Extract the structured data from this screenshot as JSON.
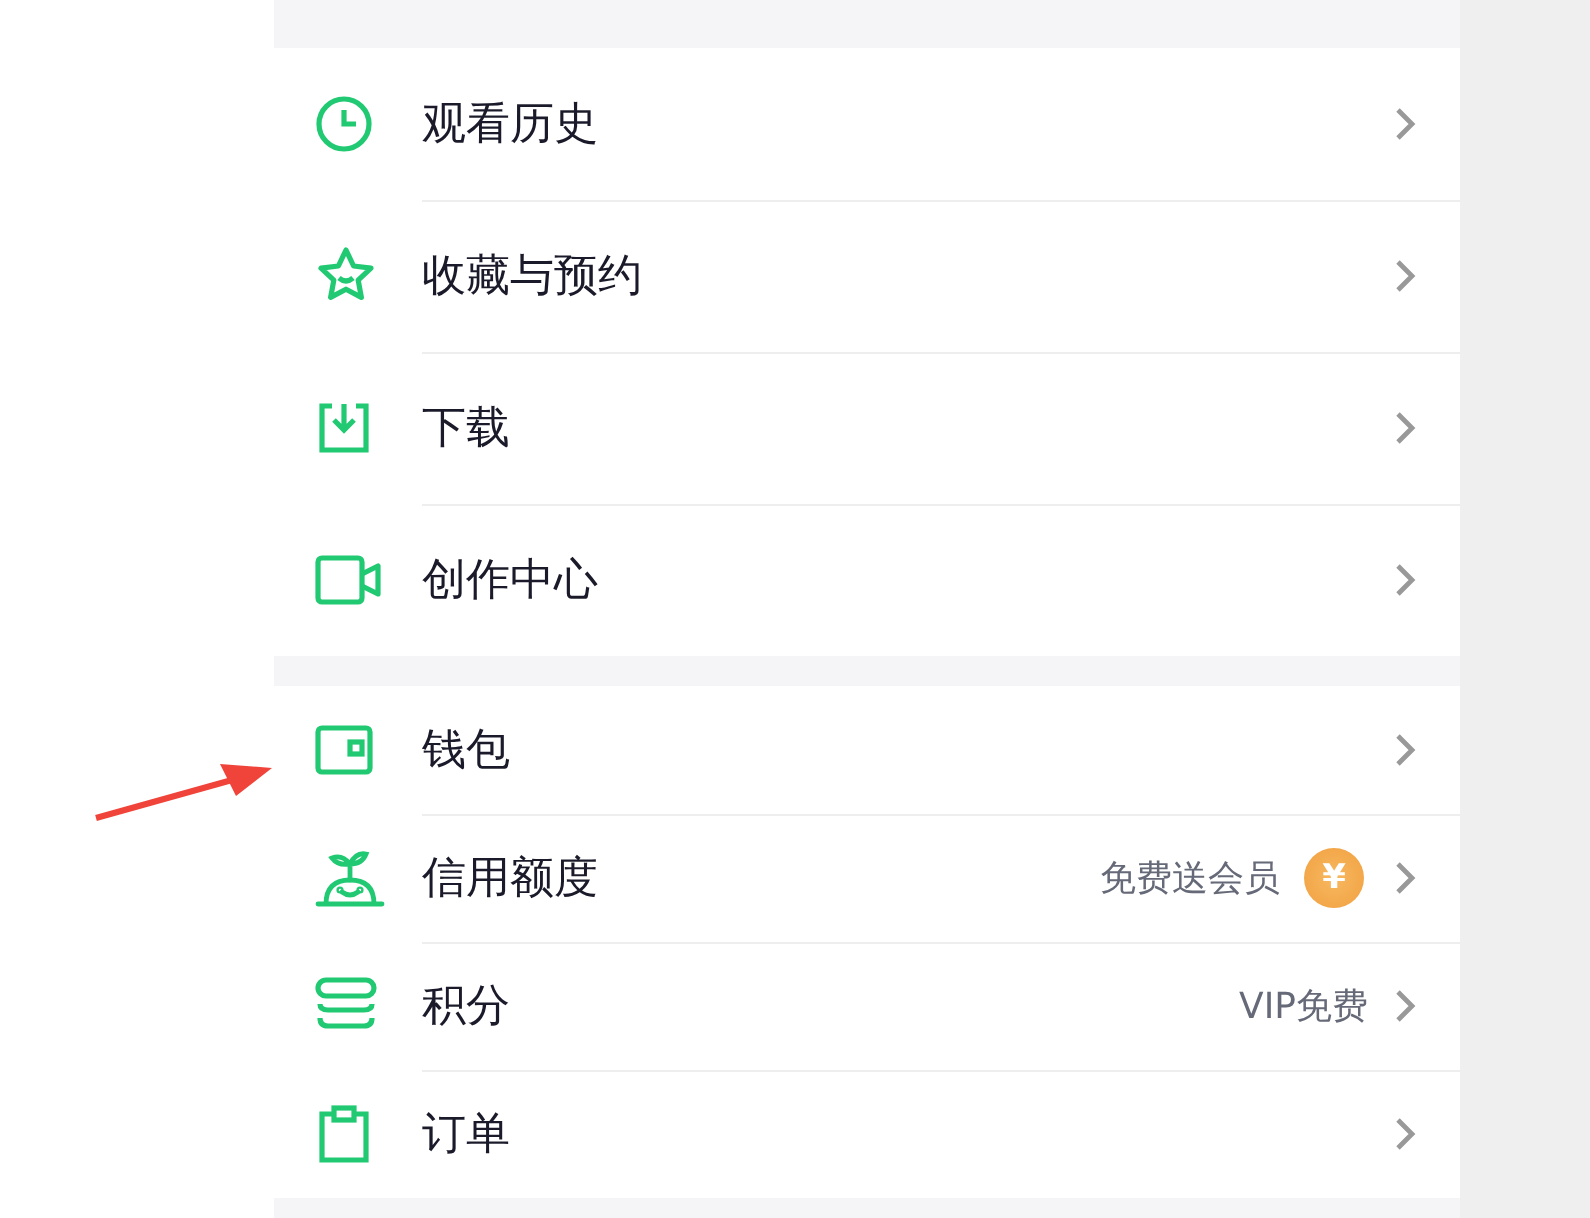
{
  "groups": [
    {
      "items": [
        {
          "label": "观看历史"
        },
        {
          "label": "收藏与预约"
        },
        {
          "label": "下载"
        },
        {
          "label": "创作中心"
        }
      ]
    },
    {
      "items": [
        {
          "label": "钱包"
        },
        {
          "label": "信用额度",
          "hint": "免费送会员",
          "badge": "¥"
        },
        {
          "label": "积分",
          "hint": "VIP免费"
        },
        {
          "label": "订单"
        }
      ]
    }
  ],
  "annotation": {
    "kind": "arrow"
  }
}
